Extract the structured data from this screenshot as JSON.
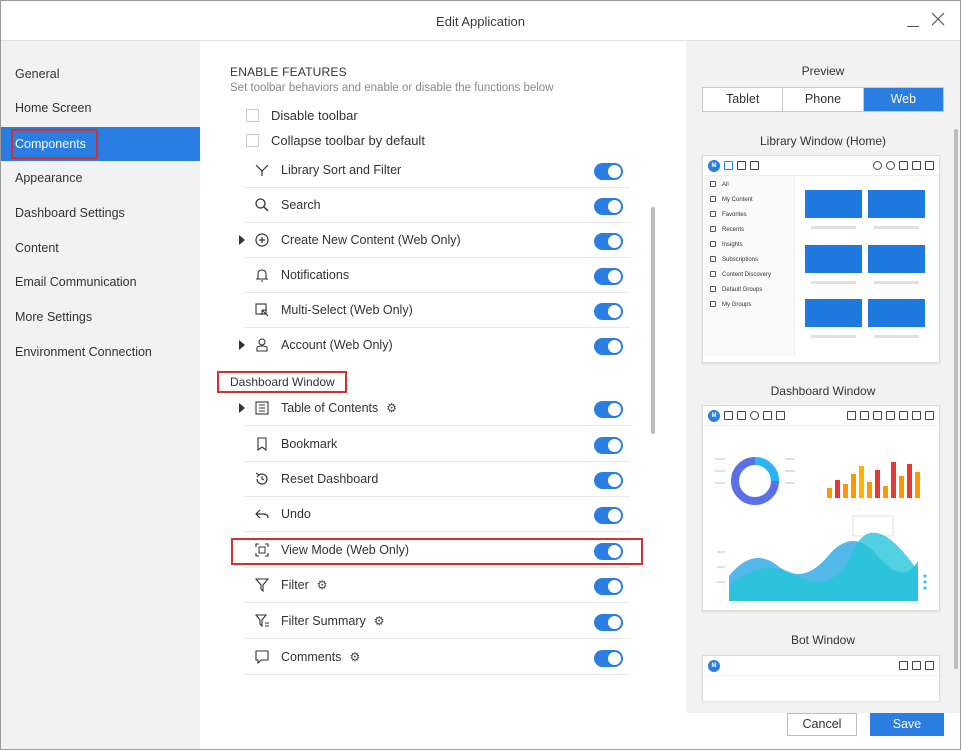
{
  "window": {
    "title": "Edit Application"
  },
  "sidebar": {
    "items": [
      {
        "label": "General"
      },
      {
        "label": "Home Screen"
      },
      {
        "label": "Components"
      },
      {
        "label": "Appearance"
      },
      {
        "label": "Dashboard Settings"
      },
      {
        "label": "Content"
      },
      {
        "label": "Email Communication"
      },
      {
        "label": "More Settings"
      },
      {
        "label": "Environment Connection"
      }
    ],
    "active": "Components"
  },
  "main": {
    "section_title": "ENABLE FEATURES",
    "section_subtitle": "Set toolbar behaviors and enable or disable the functions below",
    "checkboxes": [
      {
        "label": "Disable toolbar",
        "checked": false
      },
      {
        "label": "Collapse toolbar by default",
        "checked": false
      }
    ],
    "library_features": [
      {
        "label": "Library Sort and Filter",
        "icon": "funnel-branch-icon",
        "enabled": true,
        "expandable": false
      },
      {
        "label": "Search",
        "icon": "search-icon",
        "enabled": true,
        "expandable": false
      },
      {
        "label": "Create New Content (Web Only)",
        "icon": "plus-circle-icon",
        "enabled": true,
        "expandable": true
      },
      {
        "label": "Notifications",
        "icon": "bell-icon",
        "enabled": true,
        "expandable": false
      },
      {
        "label": "Multi-Select (Web Only)",
        "icon": "multi-select-icon",
        "enabled": true,
        "expandable": false
      },
      {
        "label": "Account (Web Only)",
        "icon": "user-icon",
        "enabled": true,
        "expandable": true
      }
    ],
    "dashboard_heading": "Dashboard Window",
    "dashboard_features": [
      {
        "label": "Table of Contents",
        "icon": "toc-icon",
        "enabled": true,
        "expandable": true,
        "gear": true
      },
      {
        "label": "Bookmark",
        "icon": "bookmark-icon",
        "enabled": true,
        "expandable": false
      },
      {
        "label": "Reset Dashboard",
        "icon": "reset-icon",
        "enabled": true,
        "expandable": false
      },
      {
        "label": "Undo",
        "icon": "undo-icon",
        "enabled": true,
        "expandable": false
      },
      {
        "label": "View Mode (Web Only)",
        "icon": "view-mode-icon",
        "enabled": true,
        "expandable": false
      },
      {
        "label": "Filter",
        "icon": "filter-icon",
        "enabled": true,
        "expandable": false,
        "gear": true
      },
      {
        "label": "Filter Summary",
        "icon": "filter-summary-icon",
        "enabled": true,
        "expandable": false,
        "gear": true
      },
      {
        "label": "Comments",
        "icon": "comment-icon",
        "enabled": true,
        "expandable": false,
        "gear": true
      }
    ]
  },
  "preview": {
    "title": "Preview",
    "tabs": [
      "Tablet",
      "Phone",
      "Web"
    ],
    "selected_tab": "Web",
    "library_title": "Library Window (Home)",
    "library_list": [
      "All",
      "My Content",
      "Favorites",
      "Recents",
      "Insights",
      "Subscriptions",
      "Content Discovery",
      "Default Groups",
      "My Groups"
    ],
    "dashboard_title": "Dashboard Window",
    "bot_title": "Bot Window"
  },
  "footer": {
    "cancel_label": "Cancel",
    "save_label": "Save"
  },
  "colors": {
    "accent": "#2a7de1",
    "highlight": "#d32f2f",
    "sidebar_bg": "#f2f2f2"
  }
}
